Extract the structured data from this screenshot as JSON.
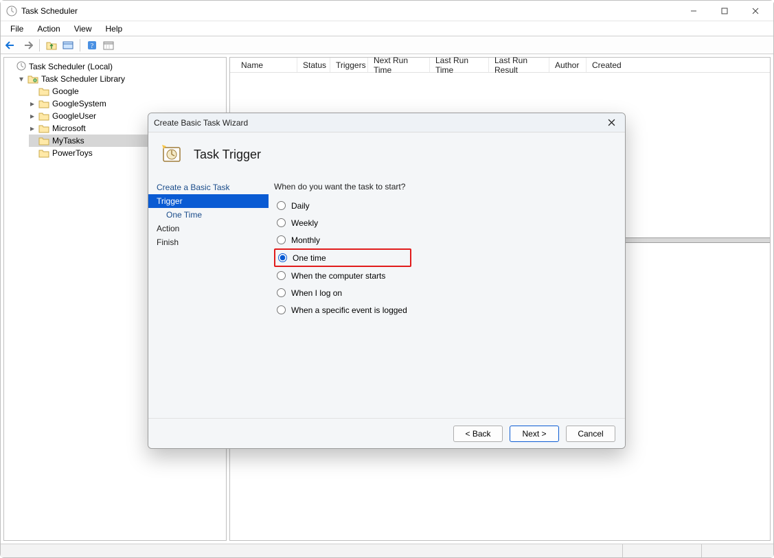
{
  "window": {
    "title": "Task Scheduler"
  },
  "menu": {
    "file": "File",
    "action": "Action",
    "view": "View",
    "help": "Help"
  },
  "tree": {
    "root": "Task Scheduler (Local)",
    "library": "Task Scheduler Library",
    "items": {
      "google": "Google",
      "googleSystem": "GoogleSystem",
      "googleUser": "GoogleUser",
      "microsoft": "Microsoft",
      "myTasks": "MyTasks",
      "powerToys": "PowerToys"
    }
  },
  "columns": {
    "name": "Name",
    "status": "Status",
    "triggers": "Triggers",
    "nextRun": "Next Run Time",
    "lastRun": "Last Run Time",
    "lastResult": "Last Run Result",
    "author": "Author",
    "created": "Created"
  },
  "dialog": {
    "title": "Create Basic Task Wizard",
    "heading": "Task Trigger",
    "steps": {
      "create": "Create a Basic Task",
      "trigger": "Trigger",
      "oneTime": "One Time",
      "action": "Action",
      "finish": "Finish"
    },
    "prompt": "When do you want the task to start?",
    "options": {
      "daily": "Daily",
      "weekly": "Weekly",
      "monthly": "Monthly",
      "oneTime": "One time",
      "computerStarts": "When the computer starts",
      "logOn": "When I log on",
      "eventLogged": "When a specific event is logged"
    },
    "selected": "oneTime",
    "buttons": {
      "back": "< Back",
      "next": "Next >",
      "cancel": "Cancel"
    }
  }
}
